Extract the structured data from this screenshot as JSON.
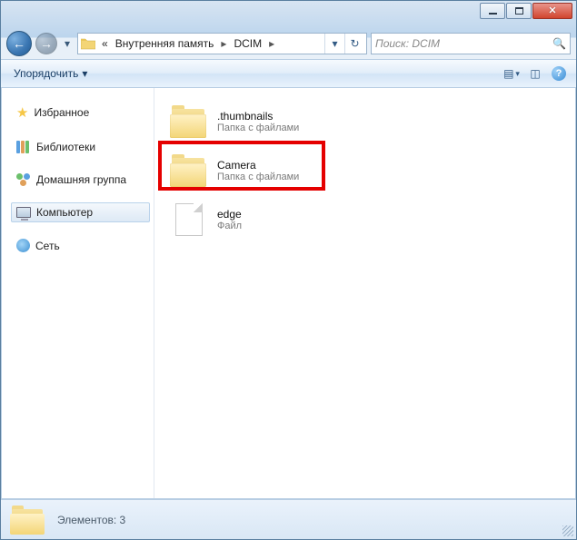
{
  "breadcrumb": {
    "prefix": "«",
    "part1": "Внутренняя память",
    "part2": "DCIM"
  },
  "search": {
    "placeholder": "Поиск: DCIM"
  },
  "toolbar": {
    "organize_label": "Упорядочить"
  },
  "nav": {
    "favorites": "Избранное",
    "libraries": "Библиотеки",
    "homegroup": "Домашняя группа",
    "computer": "Компьютер",
    "network": "Сеть"
  },
  "items": [
    {
      "name": ".thumbnails",
      "sub": "Папка с файлами",
      "type": "folder"
    },
    {
      "name": "Camera",
      "sub": "Папка с файлами",
      "type": "folder"
    },
    {
      "name": "edge",
      "sub": "Файл",
      "type": "file"
    }
  ],
  "status": {
    "text": "Элементов: 3"
  }
}
